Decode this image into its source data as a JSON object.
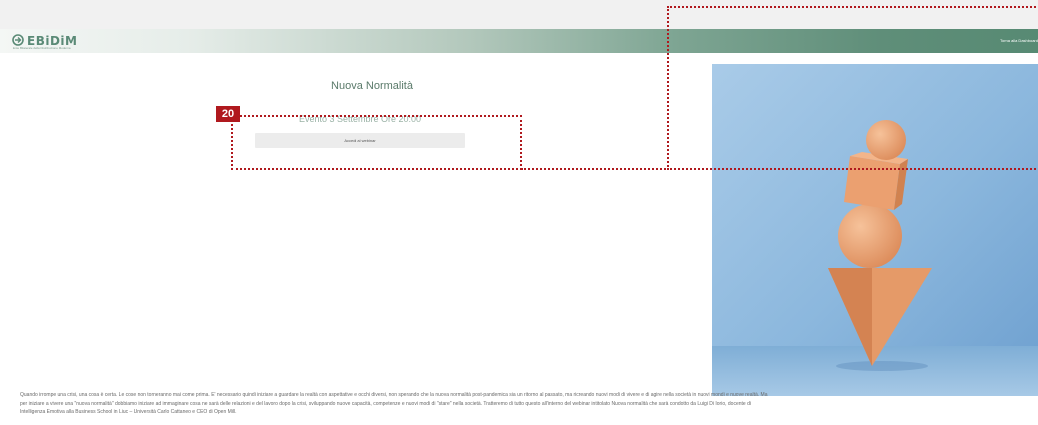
{
  "header": {
    "logo_text": "EBiDiM",
    "logo_subtitle": "Ente Bilaterale della Distribuzione Moderna",
    "back_link": "Torna alla Dashboard"
  },
  "main": {
    "title": "Nuova Normalità",
    "subtitle": "Evento 3 Settembre Ore 20:00",
    "webinar_button": "Accedi al webinar"
  },
  "description": {
    "line1": "Quando irrompe una crisi, una cosa è certa. Le cose non torneranno mai come prima. E' necessario quindi iniziare a guardare la realtà con aspettative e occhi diversi, non sperando che la nuova normalità post-pandemica sia un ritorno al passato, ma ricreando nuovi modi di vivere e di agire nella società in nuovi mondi e nuove realtà. Ma",
    "line2": "per iniziare a vivere una \"nuova normalità\" dobbiamo iniziare ad immaginare cosa ne sarà delle relazioni e del lavoro dopo la crisi, sviluppando nuove capacità, competenze e nuovi modi di \"stare\" nella società. Tratteremo di tutto questo all'interno del webinar intitolato Nuova normalità che sarà condotto da Luigi Di Iorio, docente di",
    "line3": "Intelligenza Emotiva alla Business School in Liuc – Università Carlo Cattaneo e CEO di Open Mill."
  },
  "annotation": {
    "badge_number": "20",
    "color": "#b0191e"
  },
  "colors": {
    "brand_green": "#578a73",
    "title_green": "#5a7a6a",
    "hero_shape": "#e9a273"
  }
}
